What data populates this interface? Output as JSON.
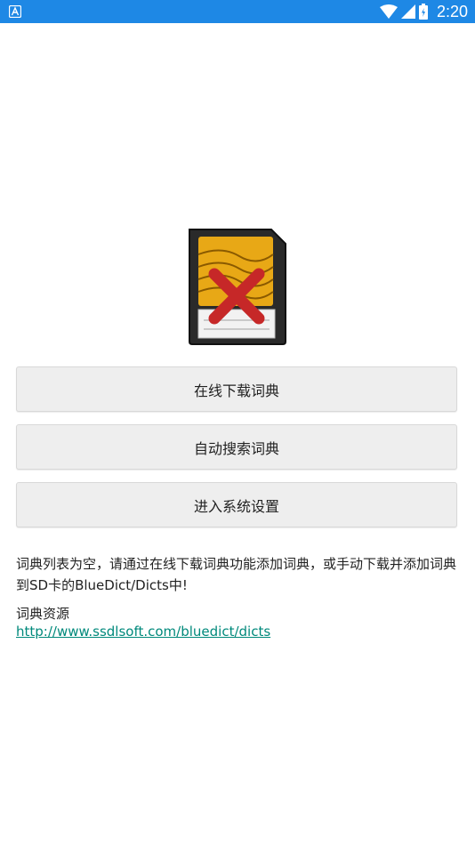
{
  "status_bar": {
    "time": "2:20",
    "left_icon": "app-notification-icon",
    "icons": [
      "wifi-icon",
      "signal-icon",
      "battery-icon"
    ],
    "background": "#1e88e5"
  },
  "main": {
    "image_icon": "sd-card-error-icon",
    "buttons": {
      "download_online": "在线下载词典",
      "auto_search": "自动搜索词典",
      "system_settings": "进入系统设置"
    },
    "message": "词典列表为空，请通过在线下载词典功能添加词典，或手动下载并添加词典到SD卡的BlueDict/Dicts中!",
    "resources_label": "词典资源",
    "resources_link": "http://www.ssdlsoft.com/bluedict/dicts"
  },
  "colors": {
    "button_bg": "#eeeeee",
    "link": "#00897b",
    "text": "#222222"
  }
}
